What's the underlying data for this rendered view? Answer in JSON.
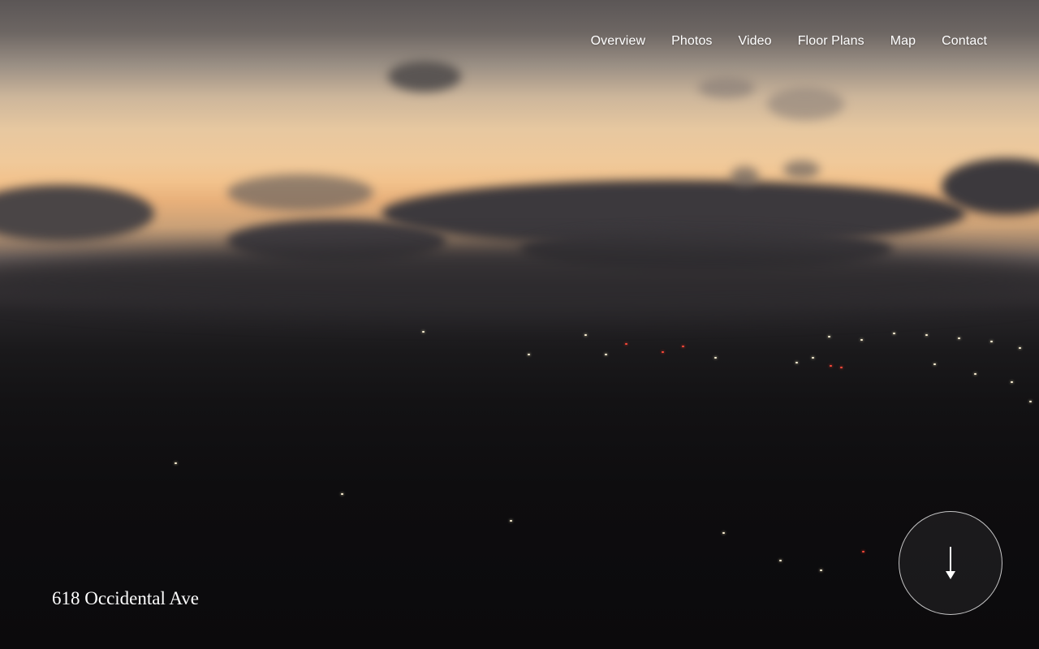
{
  "nav": {
    "items": [
      {
        "label": "Overview"
      },
      {
        "label": "Photos"
      },
      {
        "label": "Video"
      },
      {
        "label": "Floor Plans"
      },
      {
        "label": "Map"
      },
      {
        "label": "Contact"
      }
    ]
  },
  "hero": {
    "address": "618 Occidental Ave",
    "scroll_icon": "arrow-down-icon"
  },
  "colors": {
    "text": "#ffffff",
    "sunset": "#f2c28c",
    "night": "#0b0a0c"
  }
}
